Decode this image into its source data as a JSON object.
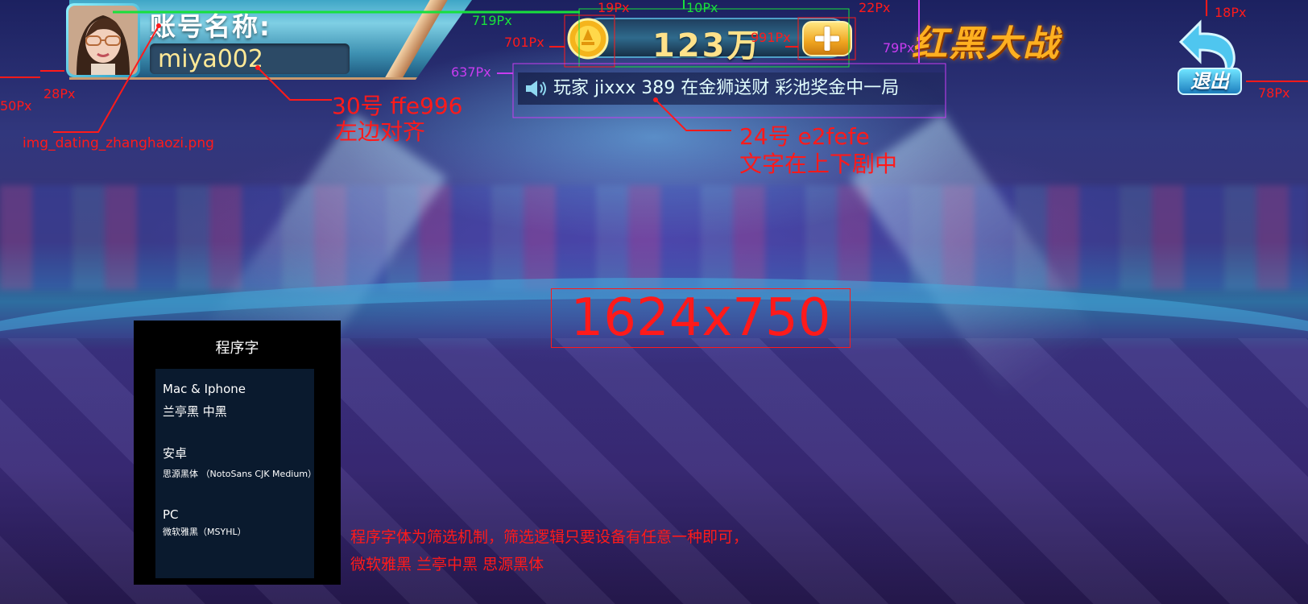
{
  "header": {
    "account_label": "账号名称:",
    "account_value": "miya002",
    "coin_value": "123万",
    "game_title": "红黑大战",
    "exit_label": "退出"
  },
  "notice": {
    "text": "玩家 jixxx 389 在金狮送财 彩池奖金中一局"
  },
  "annotations": {
    "dim_19": "19Px",
    "dim_10": "10Px",
    "dim_22": "22Px",
    "dim_18": "18Px",
    "dim_719": "719Px",
    "dim_701": "701Px",
    "dim_991": "991Px",
    "dim_79": "79Px",
    "dim_637": "637Px",
    "dim_28": "28Px",
    "dim_50": "50Px",
    "dim_78": "78Px",
    "account_spec_line1": "30号 ffe996",
    "account_spec_line2": "左边对齐",
    "avatar_asset": "img_dating_zhanghaozi.png",
    "notice_spec_line1": "24号 e2fefe",
    "notice_spec_line2": "文字在上下剧中",
    "canvas_size": "1624x750",
    "font_rule_line1": "程序字体为筛选机制，筛选逻辑只要设备有任意一种即可，",
    "font_rule_line2": "微软雅黑 兰亭中黑 思源黑体"
  },
  "font_panel": {
    "title": "程序字",
    "mac_head": "Mac & Iphone",
    "mac_font": "兰亭黑 中黑",
    "android_head": "安卓",
    "android_font": "思源黑体 （NotoSans CJK Medium）",
    "pc_head": "PC",
    "pc_font": "微软雅黑（MSYHL）"
  },
  "colors": {
    "account_text": "#ffe996",
    "notice_text": "#e2fefe",
    "annotation_red": "#ff1a1a",
    "annotation_green": "#18e03c",
    "annotation_purple": "#c83cf0"
  }
}
